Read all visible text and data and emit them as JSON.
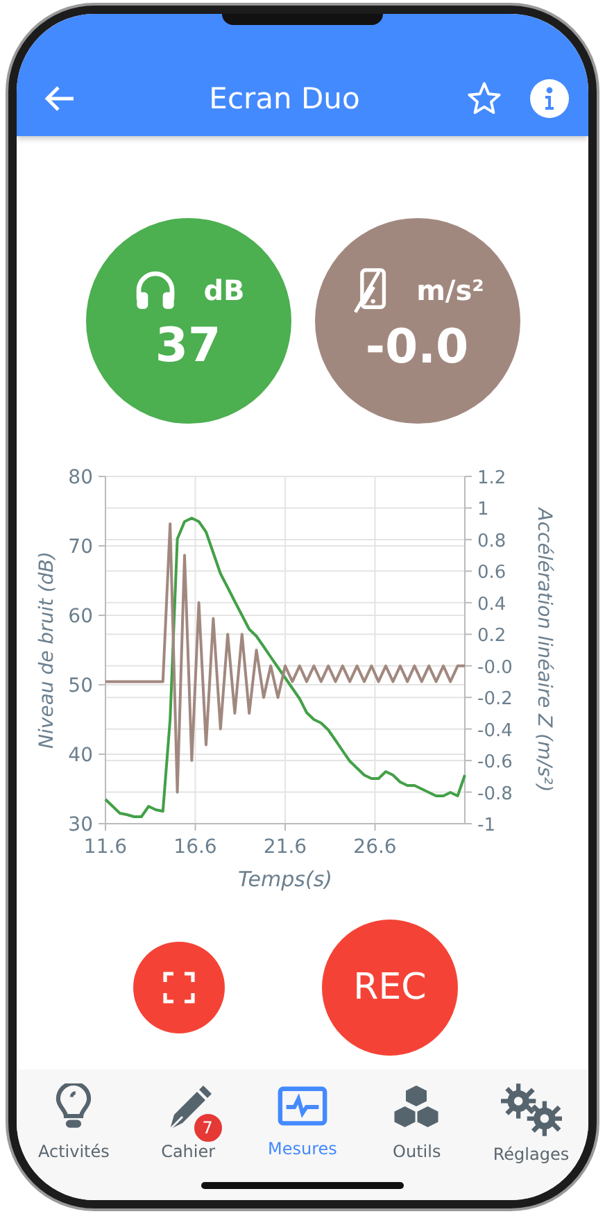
{
  "header": {
    "title": "Ecran Duo"
  },
  "readouts": [
    {
      "kind": "sound",
      "unit": "dB",
      "value": "37",
      "color": "#4caf50"
    },
    {
      "kind": "accel",
      "unit": "m/s²",
      "value": "-0.0",
      "color": "#a1887f"
    }
  ],
  "chart": {
    "chart_data": {
      "type": "line",
      "xlabel": "Temps(s)",
      "ylabel": "Niveau de bruit (dB)",
      "y2label": "Accélération linéaire Z (m/s²)",
      "x": [
        11.6,
        12.0,
        12.4,
        12.8,
        13.2,
        13.6,
        14.0,
        14.4,
        14.8,
        15.2,
        15.6,
        16.0,
        16.4,
        16.8,
        17.2,
        17.6,
        18.0,
        18.4,
        18.8,
        19.2,
        19.6,
        20.0,
        20.4,
        20.8,
        21.2,
        21.6,
        22.0,
        22.4,
        22.8,
        23.2,
        23.6,
        24.0,
        24.4,
        24.8,
        25.2,
        25.6,
        26.0,
        26.4,
        26.8,
        27.2,
        27.6,
        28.0,
        28.4,
        28.8,
        29.2,
        29.6,
        30.0,
        30.4,
        30.8,
        31.2,
        31.6
      ],
      "xlim": [
        11.6,
        31.6
      ],
      "ylim": [
        30,
        80
      ],
      "y2lim": [
        -1,
        1.2
      ],
      "grid": true,
      "xticks": [
        11.6,
        16.6,
        21.6,
        26.6
      ],
      "yticks": [
        30,
        40,
        50,
        60,
        70,
        80
      ],
      "y2ticks": [
        -1,
        -0.8,
        -0.6,
        -0.4,
        -0.2,
        {
          "value": 0,
          "label": "-0.0"
        },
        0.2,
        0.4,
        0.6,
        0.8,
        1,
        1.2
      ],
      "series": [
        {
          "color": "#43a047",
          "values": [
            33.5,
            32.5,
            31.5,
            31.3,
            31,
            31,
            32.5,
            32,
            31.8,
            45,
            71,
            73.5,
            74,
            73.5,
            72,
            69,
            66,
            64,
            62,
            60,
            58,
            57,
            55.5,
            54,
            52.5,
            51,
            49.5,
            48,
            46,
            45,
            44.5,
            43.5,
            42,
            40.5,
            39,
            38,
            37,
            36.5,
            36.5,
            37.5,
            37,
            36,
            35.5,
            35.5,
            35,
            34.5,
            34,
            34,
            34.5,
            34,
            37
          ]
        },
        {
          "color": "#a1887f",
          "axis": "y2",
          "values": [
            -0.1,
            -0.1,
            -0.1,
            -0.1,
            -0.1,
            -0.1,
            -0.1,
            -0.1,
            -0.1,
            0.9,
            -0.8,
            0.7,
            -0.6,
            0.4,
            -0.5,
            0.3,
            -0.4,
            0.2,
            -0.3,
            0.2,
            -0.3,
            0.1,
            -0.2,
            0.0,
            -0.2,
            0.0,
            -0.1,
            0.0,
            -0.1,
            0.0,
            -0.1,
            0.0,
            -0.1,
            0.0,
            -0.1,
            0.0,
            -0.1,
            0.0,
            -0.1,
            0.0,
            -0.1,
            0.0,
            -0.1,
            0.0,
            -0.1,
            0.0,
            -0.1,
            0.0,
            -0.1,
            0.0,
            0.0
          ]
        }
      ]
    }
  },
  "record_button": {
    "label": "REC"
  },
  "nav": [
    {
      "kind": "bulb",
      "label": "Activités",
      "selected": false
    },
    {
      "kind": "pen",
      "label": "Cahier",
      "selected": false,
      "badge": "7"
    },
    {
      "kind": "monitor",
      "label": "Mesures",
      "selected": true
    },
    {
      "kind": "cubes",
      "label": "Outils",
      "selected": false
    },
    {
      "kind": "gears",
      "label": "Réglages",
      "selected": false
    }
  ]
}
